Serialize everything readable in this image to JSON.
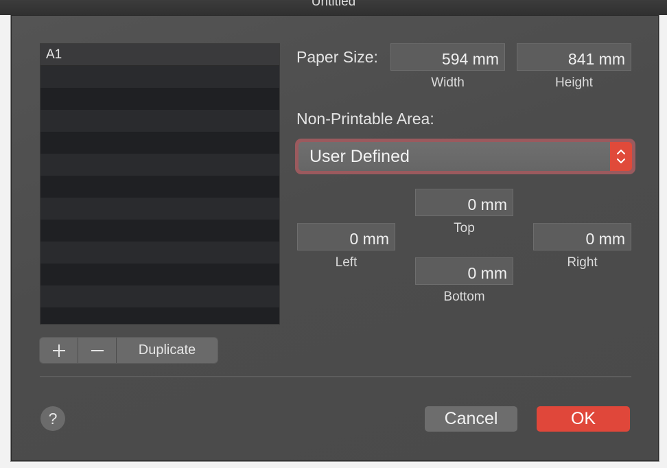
{
  "window": {
    "title": "Untitled"
  },
  "paper_list": {
    "items": [
      "A1"
    ],
    "selected": "A1"
  },
  "list_buttons": {
    "add": "+",
    "remove": "—",
    "duplicate": "Duplicate"
  },
  "paper_size": {
    "label": "Paper Size:",
    "width_value": "594 mm",
    "width_label": "Width",
    "height_value": "841 mm",
    "height_label": "Height"
  },
  "non_printable": {
    "label": "Non-Printable Area:",
    "selected": "User Defined"
  },
  "margins": {
    "top_value": "0 mm",
    "top_label": "Top",
    "left_value": "0 mm",
    "left_label": "Left",
    "right_value": "0 mm",
    "right_label": "Right",
    "bottom_value": "0 mm",
    "bottom_label": "Bottom"
  },
  "footer": {
    "help": "?",
    "cancel": "Cancel",
    "ok": "OK"
  },
  "colors": {
    "accent": "#e0473a",
    "focus_ring": "#9b5a5e",
    "sheet_bg": "#4e4e4e",
    "list_bg": "#1f2023"
  }
}
